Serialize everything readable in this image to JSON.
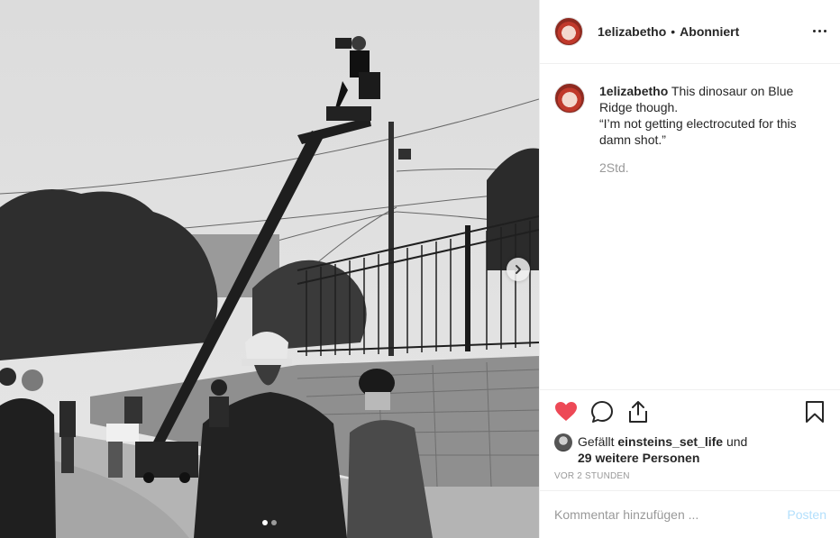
{
  "header": {
    "username": "1elizabetho",
    "separator": "•",
    "follow_status": "Abonniert",
    "more_icon": "more-horizontal-icon"
  },
  "caption": {
    "username": "1elizabetho",
    "lines": [
      "This dinosaur on Blue",
      "Ridge though.",
      "“I’m not getting electrocuted for this",
      "damn shot.”"
    ],
    "time": "2Std."
  },
  "actions": {
    "like_icon": "heart-filled-icon",
    "comment_icon": "comment-icon",
    "share_icon": "share-icon",
    "save_icon": "bookmark-icon",
    "like_color": "#ed4956"
  },
  "likes": {
    "prefix": "Gefällt",
    "liker": "einsteins_set_life",
    "joiner": "und",
    "others": "29 weitere Personen"
  },
  "timestamp": "VOR 2 STUNDEN",
  "comment_box": {
    "placeholder": "Kommentar hinzufügen ...",
    "post_label": "Posten",
    "post_color": "#b2dffc"
  },
  "carousel": {
    "total": 2,
    "current": 1,
    "next_icon": "chevron-right-icon"
  }
}
